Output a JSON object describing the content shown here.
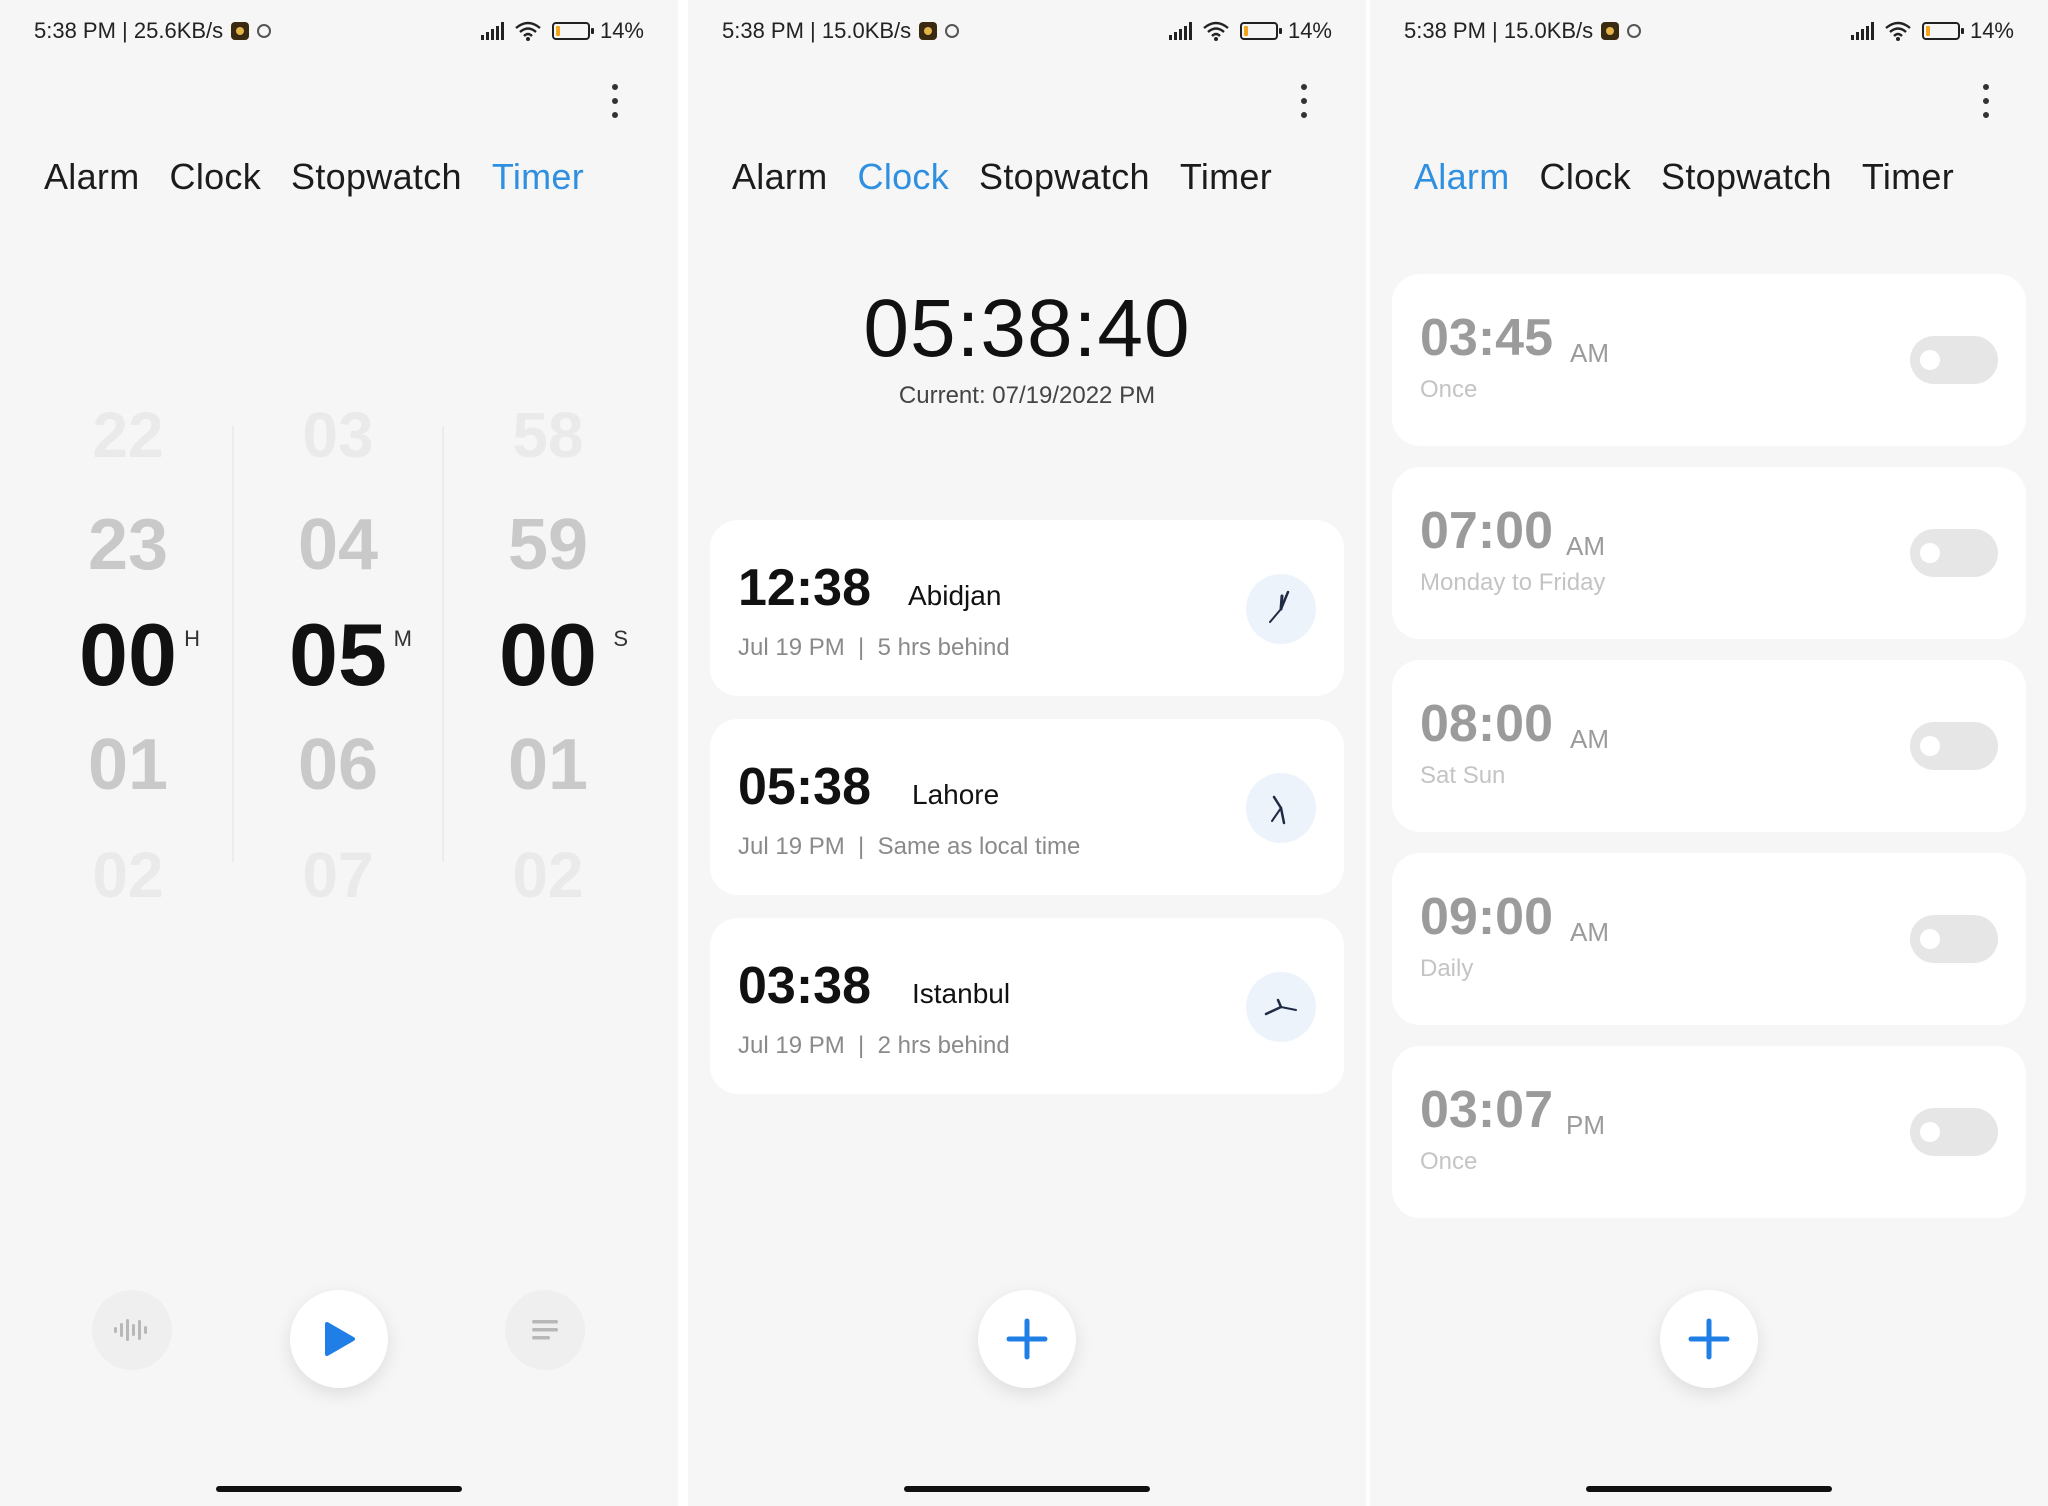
{
  "status_bars": [
    {
      "time_speed": "5:38 PM | 25.6KB/s",
      "battery": "14%",
      "battery_level": 0.14
    },
    {
      "time_speed": "5:38 PM | 15.0KB/s",
      "battery": "14%",
      "battery_level": 0.14
    },
    {
      "time_speed": "5:38 PM | 15.0KB/s",
      "battery": "14%",
      "battery_level": 0.14
    }
  ],
  "tabs": [
    "Alarm",
    "Clock",
    "Stopwatch",
    "Timer"
  ],
  "accent_color": "#2f8fe0",
  "timer": {
    "hours": {
      "values": [
        "22",
        "23",
        "00",
        "01",
        "02"
      ],
      "unit": "H"
    },
    "minutes": {
      "values": [
        "03",
        "04",
        "05",
        "06",
        "07"
      ],
      "unit": "M"
    },
    "seconds": {
      "values": [
        "58",
        "59",
        "00",
        "01",
        "02"
      ],
      "unit": "S"
    },
    "left_button_icon": "sound-wave-icon",
    "play_button_icon": "play-icon",
    "right_button_icon": "list-icon"
  },
  "clock": {
    "current_time": "05:38:40",
    "current_date": "Current: 07/19/2022 PM",
    "cities": [
      {
        "time": "12:38",
        "city": "Abidjan",
        "date": "Jul 19 PM",
        "offset": "5 hrs behind"
      },
      {
        "time": "05:38",
        "city": "Lahore",
        "date": "Jul 19 PM",
        "offset": "Same as local time"
      },
      {
        "time": "03:38",
        "city": "Istanbul",
        "date": "Jul 19 PM",
        "offset": "2 hrs behind"
      }
    ],
    "add_icon": "plus-icon"
  },
  "alarms": [
    {
      "time": "03:45",
      "ampm": "AM",
      "repeat": "Once",
      "enabled": false
    },
    {
      "time": "07:00",
      "ampm": "AM",
      "repeat": "Monday to Friday",
      "enabled": false
    },
    {
      "time": "08:00",
      "ampm": "AM",
      "repeat": "Sat Sun",
      "enabled": false
    },
    {
      "time": "09:00",
      "ampm": "AM",
      "repeat": "Daily",
      "enabled": false
    },
    {
      "time": "03:07",
      "ampm": "PM",
      "repeat": "Once",
      "enabled": false
    }
  ]
}
